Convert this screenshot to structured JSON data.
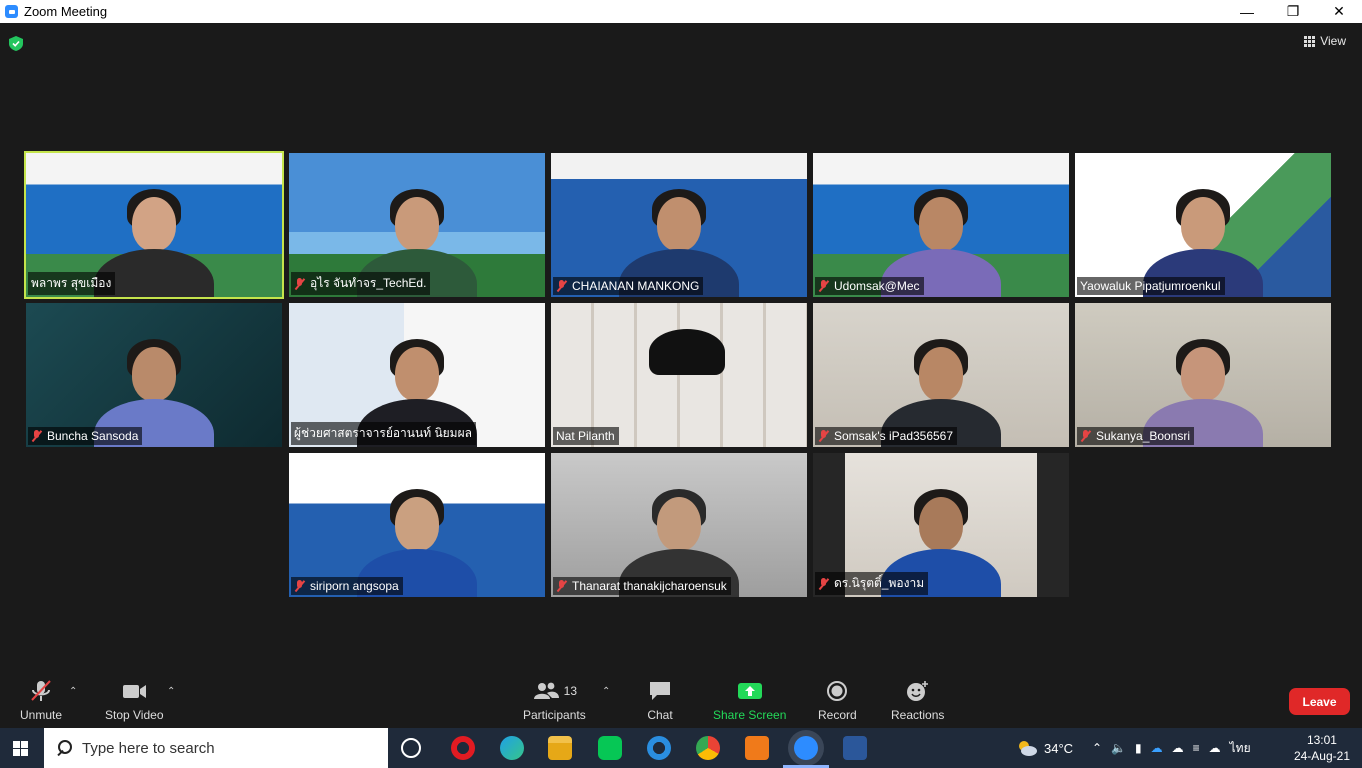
{
  "window": {
    "title": "Zoom Meeting"
  },
  "view_label": "View",
  "participants": [
    {
      "name": "พลาพร สุขเมือง",
      "muted": false,
      "active": true
    },
    {
      "name": "อุไร จันทำจร_TechEd.",
      "muted": true,
      "active": false
    },
    {
      "name": "CHAIANAN MANKONG",
      "muted": true,
      "active": false
    },
    {
      "name": "Udomsak@Mec",
      "muted": true,
      "active": false
    },
    {
      "name": "Yaowaluk Pipatjumroenkul",
      "muted": false,
      "active": false
    },
    {
      "name": "Buncha Sansoda",
      "muted": true,
      "active": false
    },
    {
      "name": "ผู้ช่วยศาสตราจารย์อานนท์ นิยมผล",
      "muted": false,
      "active": false
    },
    {
      "name": "Nat Pilanth",
      "muted": false,
      "active": false
    },
    {
      "name": "Somsak's iPad356567",
      "muted": true,
      "active": false
    },
    {
      "name": "Sukanya_Boonsri",
      "muted": true,
      "active": false
    },
    {
      "name": "siriporn angsopa",
      "muted": true,
      "active": false
    },
    {
      "name": "Thanarat thanakijcharoensuk",
      "muted": true,
      "active": false
    },
    {
      "name": "ดร.นิรุตติ์_พองาม",
      "muted": true,
      "active": false
    }
  ],
  "toolbar": {
    "unmute": "Unmute",
    "stop_video": "Stop Video",
    "participants": "Participants",
    "participants_count": "13",
    "chat": "Chat",
    "share_screen": "Share Screen",
    "record": "Record",
    "reactions": "Reactions",
    "leave": "Leave"
  },
  "taskbar": {
    "search_placeholder": "Type here to search",
    "weather_temp": "34°C",
    "language": "ไทย",
    "time": "13:01",
    "date": "24-Aug-21"
  },
  "colors": {
    "active_speaker": "#c4e44c",
    "share_screen": "#23d959",
    "leave": "#e02828",
    "muted_icon": "#e54444"
  }
}
